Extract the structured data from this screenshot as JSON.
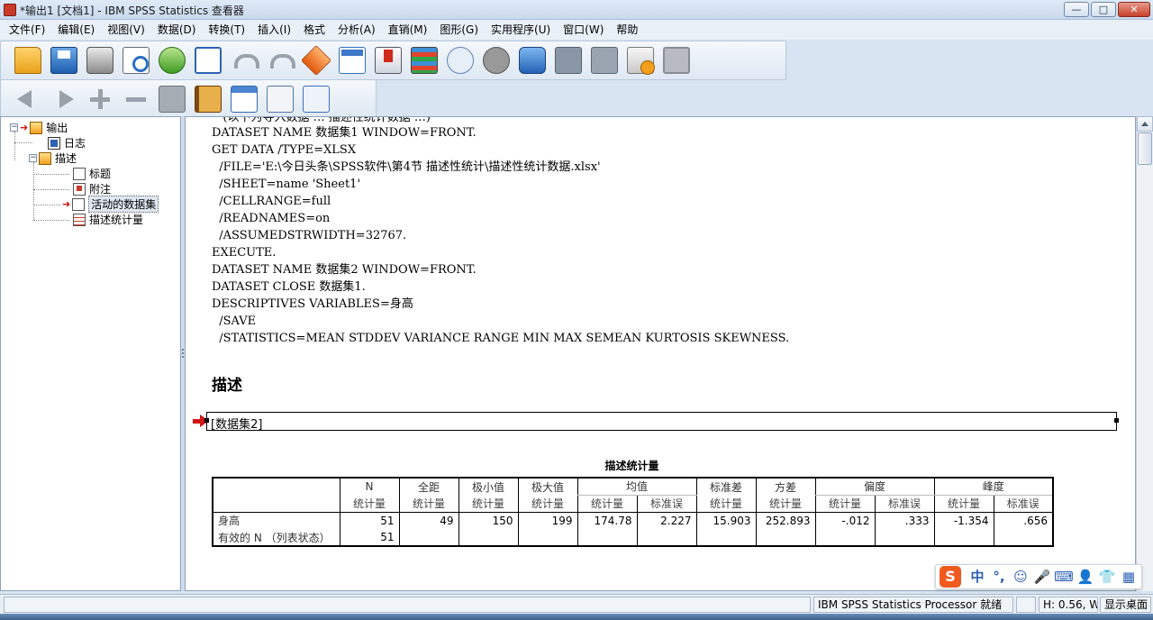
{
  "window": {
    "title": "*输出1 [文档1] - IBM SPSS Statistics 查看器",
    "minimize_glyph": "—",
    "maximize_glyph": "□",
    "close_glyph": "✕"
  },
  "menubar": {
    "items": [
      "文件(F)",
      "编辑(E)",
      "视图(V)",
      "数据(D)",
      "转换(T)",
      "插入(I)",
      "格式",
      "分析(A)",
      "直销(M)",
      "图形(G)",
      "实用程序(U)",
      "窗口(W)",
      "帮助"
    ]
  },
  "toolbar_main": {
    "icons": [
      "open-icon",
      "save-icon",
      "print-icon",
      "print-preview-icon",
      "export-icon",
      "recall-dialog-icon",
      "undo-icon",
      "redo-icon",
      "goto-case-icon",
      "goto-variable-icon",
      "insert-cases-icon",
      "chart-builder-icon",
      "weight-cases-icon",
      "select-cases-icon",
      "value-labels-icon",
      "use-sets-icon",
      "designate-window-icon",
      "run-script-icon",
      "gray-panel-icon"
    ]
  },
  "toolbar_output": {
    "icons": [
      "back-arrow-icon",
      "forward-arrow-icon",
      "expand-icon",
      "collapse-icon",
      "hide-icon",
      "book-icon",
      "pivot-icon",
      "copy-icon",
      "swap-icon"
    ]
  },
  "outline": {
    "root": "输出",
    "log": "日志",
    "descriptives": "描述",
    "children": [
      "标题",
      "附注",
      "活动的数据集",
      "描述统计量"
    ]
  },
  "syntax": {
    "cut_line": "   (以下为导入数据 … 描述性统计数据 …)",
    "lines": [
      "DATASET NAME 数据集1 WINDOW=FRONT.",
      "GET DATA /TYPE=XLSX",
      "  /FILE='E:\\今日头条\\SPSS软件\\第4节 描述性统计\\描述性统计数据.xlsx'",
      "  /SHEET=name 'Sheet1'",
      "  /CELLRANGE=full",
      "  /READNAMES=on",
      "  /ASSUMEDSTRWIDTH=32767.",
      "EXECUTE.",
      "DATASET NAME 数据集2 WINDOW=FRONT.",
      "DATASET CLOSE 数据集1.",
      "DESCRIPTIVES VARIABLES=身高",
      "  /SAVE",
      "  /STATISTICS=MEAN STDDEV VARIANCE RANGE MIN MAX SEMEAN KURTOSIS SKEWNESS."
    ]
  },
  "output": {
    "heading": "描述",
    "dataset_label": "[数据集2]",
    "table_title": "描述统计量",
    "header1": [
      "N",
      "全距",
      "极小值",
      "极大值",
      "均值",
      "标准差",
      "方差",
      "偏度",
      "峰度"
    ],
    "header2": [
      "统计量",
      "统计量",
      "统计量",
      "统计量",
      "统计量",
      "标准误",
      "统计量",
      "统计量",
      "统计量",
      "标准误",
      "统计量",
      "标准误"
    ],
    "rows": [
      {
        "label": "身高",
        "values": [
          "51",
          "49",
          "150",
          "199",
          "174.78",
          "2.227",
          "15.903",
          "252.893",
          "-.012",
          ".333",
          "-1.354",
          ".656"
        ]
      },
      {
        "label": "有效的 N （列表状态）",
        "values": [
          "51",
          "",
          "",
          "",
          "",
          "",
          "",
          "",
          "",
          "",
          "",
          ""
        ]
      }
    ]
  },
  "ime": {
    "logo": "S",
    "segments": [
      "中",
      "°,",
      "☺",
      "🎤",
      "⌨",
      "👤",
      "👕",
      "▦"
    ]
  },
  "statusbar": {
    "processor": "IBM SPSS Statistics Processor 就绪",
    "position": "H: 0.56, W:",
    "show_desktop": "显示桌面"
  }
}
